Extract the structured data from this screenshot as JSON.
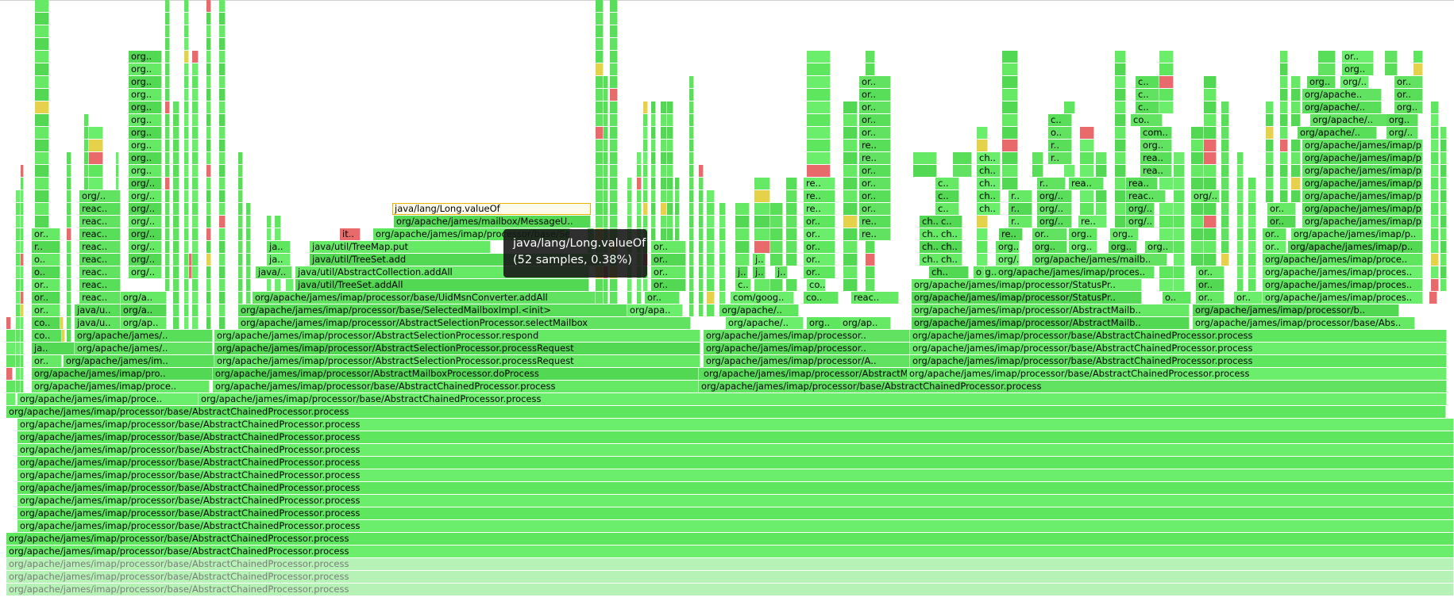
{
  "frames": {
    "base": "org/apache/james/imap/processor/base/AbstractChainedProcessor.process",
    "abstract_mailbox_do_process": "org/apache/james/imap/processor/AbstractMailboxProcessor.doProcess",
    "abstract_selection_process_request": "org/apache/james/imap/processor/AbstractSelectionProcessor.processRequest",
    "abstract_selection_respond": "org/apache/james/imap/processor/AbstractSelectionProcessor.respond",
    "abstract_selection_select_mailbox": "org/apache/james/imap/processor/AbstractSelectionProcessor.selectMailbox",
    "selected_mailbox_init": "org/apache/james/imap/processor/base/SelectedMailboxImpl.<init>",
    "uid_msn_add_all": "org/apache/james/imap/processor/base/UidMsnConverter.addAll",
    "abstract_collection_add_all": "java/util/AbstractCollection.addAll",
    "treeset_add_all": "java/util/TreeSet.addAll",
    "treeset_add": "java/util/TreeSet.add",
    "treemap_put": "java/util/TreeMap.put",
    "message_u": "org/apache/james/mailbox/MessageU..",
    "long_value_of": "java/lang/Long.valueOf",
    "status_processor": "org/apache/james/imap/processor/StatusPr..",
    "abstract_mailb": "org/apache/james/imap/processor/AbstractMailb..",
    "abstract_mailbox_short": "org/apache/james/imap/processor/AbstractMailbox..",
    "imap_proces": "org/apache/james/imap/proces..",
    "base_abs": "org/apache/james/imap/processor/base/Abs..",
    "imap_b": "org/apache/james/imap/processor/b..",
    "imap_proce": "org/apache/james/imap/proce..",
    "imap_p": "org/apache/james/imap/p..",
    "mailb": "org/apache/james/mailb..",
    "imap_a": "org/apache/james/imap/processor/A..",
    "imap_processor_short": "org/apache/james/imap/processor..",
    "apache_imap": "org/apache/james/imap..",
    "apache_short": "org/apache/..",
    "apache_ellipsis": "org/apache..",
    "apache_james": "org/apache/james/..",
    "apache_james_im": "org/apache/james/im..",
    "imap_pro": "org/apache/james/imap/pro..",
    "imap_proce2": "org/apache/james/imap/proce..",
    "com_goog": "com/goog..",
    "org_a": "org/a..",
    "org_ap": "org/ap..",
    "org_apa": "org/apa..",
    "org_slash": "org/..",
    "org": "org..",
    "org_short": "org.",
    "or": "or..",
    "o": "o..",
    "reac": "reac..",
    "rea": "rea..",
    "re": "re..",
    "r": "r..",
    "java_u": "java/u..",
    "java_slash": "java/..",
    "ja": "ja..",
    "j": "j..",
    "jav": "jav..",
    "co": "co..",
    "c": "c..",
    "ch": "ch..",
    "com": "com..",
    "it": "it.."
  },
  "tooltip": {
    "line1": "java/lang/Long.valueOf",
    "line2": "(52 samples, 0.38%)"
  },
  "colors": {
    "background": "#ffffff",
    "frame_greens": [
      "#5ee65e",
      "#66ea66",
      "#58de58",
      "#6bee6b",
      "#52d852",
      "#61e261"
    ],
    "faded_green": "#b6f2b6",
    "hot_red": "#e86a6a",
    "yellow": "#e6d24a",
    "highlight_fill": "#fffbea",
    "highlight_border": "#e8b400",
    "tooltip_bg": "#181818"
  }
}
